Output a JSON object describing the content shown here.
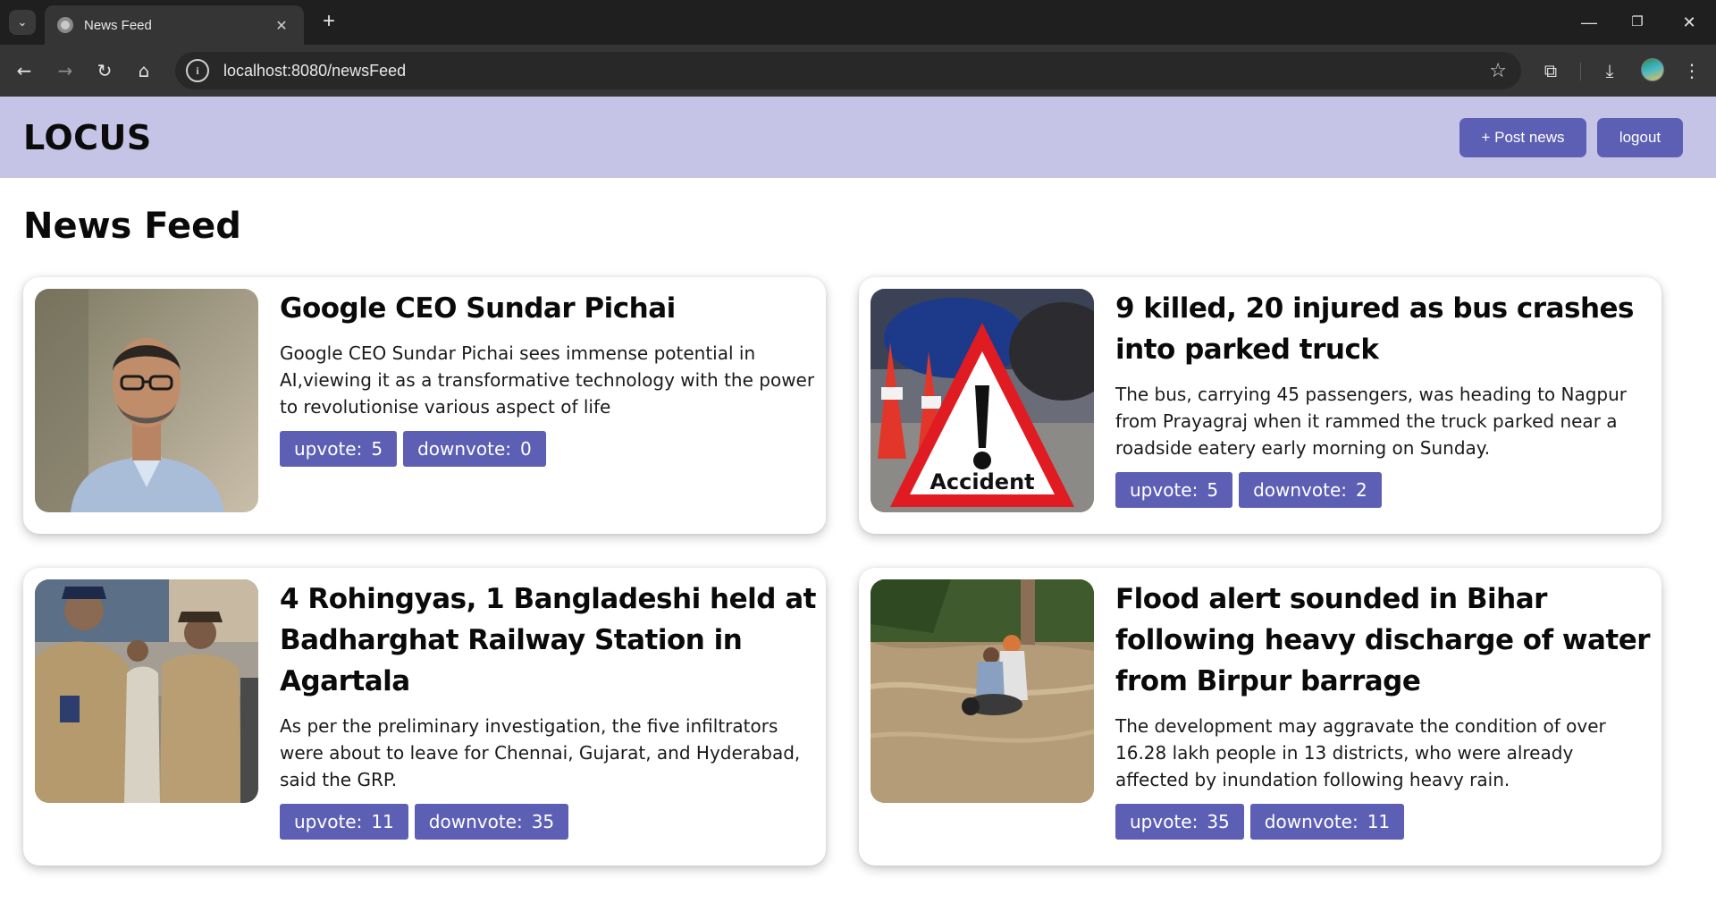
{
  "browser": {
    "tab_title": "News Feed",
    "url": "localhost:8080/newsFeed"
  },
  "header": {
    "logo": "LOCUS",
    "post_button": "+ Post news",
    "logout_button": "logout"
  },
  "page": {
    "title": "News Feed"
  },
  "vote_labels": {
    "upvote": "upvote:",
    "downvote": "downvote:"
  },
  "posts": [
    {
      "title": "Google CEO Sundar Pichai",
      "description": "Google CEO Sundar Pichai sees immense potential in AI,viewing it as a transformative technology with the power to revolutionise various aspect of life",
      "upvotes": "5",
      "downvotes": "0"
    },
    {
      "title": "9 killed, 20 injured as bus crashes into parked truck",
      "description": "The bus, carrying 45 passengers, was heading to Nagpur from Prayagraj when it rammed the truck parked near a roadside eatery early morning on Sunday.",
      "upvotes": "5",
      "downvotes": "2",
      "image_caption": "Accident"
    },
    {
      "title": "4 Rohingyas, 1 Bangladeshi held at Badharghat Railway Station in Agartala",
      "description": "As per the preliminary investigation, the five infiltrators were about to leave for Chennai, Gujarat, and Hyderabad, said the GRP.",
      "upvotes": "11",
      "downvotes": "35"
    },
    {
      "title": "Flood alert sounded in Bihar following heavy discharge of water from Birpur barrage",
      "description": "The development may aggravate the condition of over 16.28 lakh people in 13 districts, who were already affected by inundation following heavy rain.",
      "upvotes": "35",
      "downvotes": "11"
    }
  ],
  "colors": {
    "header_bg": "#c5c3e6",
    "accent": "#5d5fb4",
    "browser_bg": "#1f1f1f"
  }
}
